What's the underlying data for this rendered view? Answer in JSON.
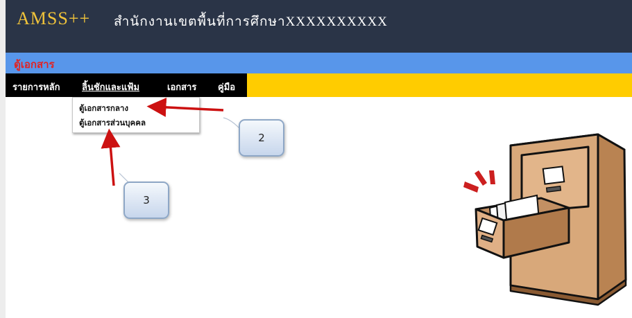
{
  "header": {
    "brand": "AMSS++",
    "org_name": "สำนักงานเขตพื้นที่การศึกษาXXXXXXXXXX"
  },
  "page_title": "ตู้เอกสาร",
  "menu": {
    "items": [
      {
        "label": "รายการหลัก"
      },
      {
        "label": "ลิ้นชักและแฟ้ม",
        "active": true
      },
      {
        "label": "เอกสาร"
      },
      {
        "label": "คู่มือ"
      }
    ]
  },
  "dropdown": {
    "items": [
      {
        "label": "ตู้เอกสารกลาง"
      },
      {
        "label": "ตู้เอกสารส่วนบุคคล"
      }
    ]
  },
  "callouts": [
    {
      "label": "2"
    },
    {
      "label": "3"
    }
  ],
  "colors": {
    "header_bg": "#2a3447",
    "brand": "#f0c33a",
    "title_bar": "#5896ea",
    "title_text": "#e02424",
    "menu_bar": "#ffcc00",
    "arrow": "#cc1111"
  },
  "illustration": "filing-cabinet-icon"
}
